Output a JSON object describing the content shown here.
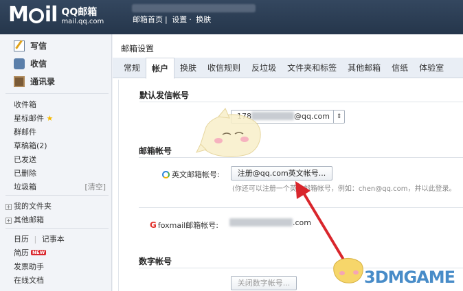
{
  "header": {
    "logo_text": "M",
    "logo_text2": "il",
    "brand": "QQ邮箱",
    "domain": "mail.qq.com",
    "links": [
      "邮箱首页",
      "设置",
      "换肤"
    ],
    "sep": "|"
  },
  "sidebar": {
    "compose": "写信",
    "inbox": "收信",
    "contacts": "通讯录",
    "folders": {
      "inbox": "收件箱",
      "starred": "星标邮件",
      "group": "群邮件",
      "drafts": "草稿箱(2)",
      "sent": "已发送",
      "deleted": "已删除",
      "trash": "垃圾箱",
      "trash_clear": "[清空]",
      "my_folders": "我的文件夹",
      "other_mail": "其他邮箱",
      "calendar": "日历",
      "notes": "记事本",
      "resume": "简历",
      "new_badge": "NEW",
      "invoice": "发票助手",
      "docs": "在线文档"
    }
  },
  "main": {
    "title": "邮箱设置",
    "tabs": [
      "常规",
      "帐户",
      "换肤",
      "收信规则",
      "反垃圾",
      "文件夹和标签",
      "其他邮箱",
      "信纸",
      "体验室"
    ],
    "active_tab": 1,
    "default_sender": {
      "heading": "默认发信帐号",
      "value_prefix": "178",
      "value_suffix": "@qq.com"
    },
    "mail_account": {
      "heading": "邮箱帐号",
      "english_label": "英文邮箱帐号:",
      "register_button": "注册@qq.com英文帐号...",
      "hint": "(你还可以注册一个英文邮箱帐号，例如：chen@qq.com，并以此登录。",
      "foxmail_label": "foxmail邮箱帐号:",
      "foxmail_suffix": ".com"
    },
    "digital_account": {
      "heading": "数字帐号",
      "close_button": "关闭数字帐号..."
    }
  },
  "watermark": "3DMGAME",
  "colors": {
    "topbar": "#2c3e57",
    "arrow": "#d9262c",
    "accent": "#2f86d8"
  }
}
